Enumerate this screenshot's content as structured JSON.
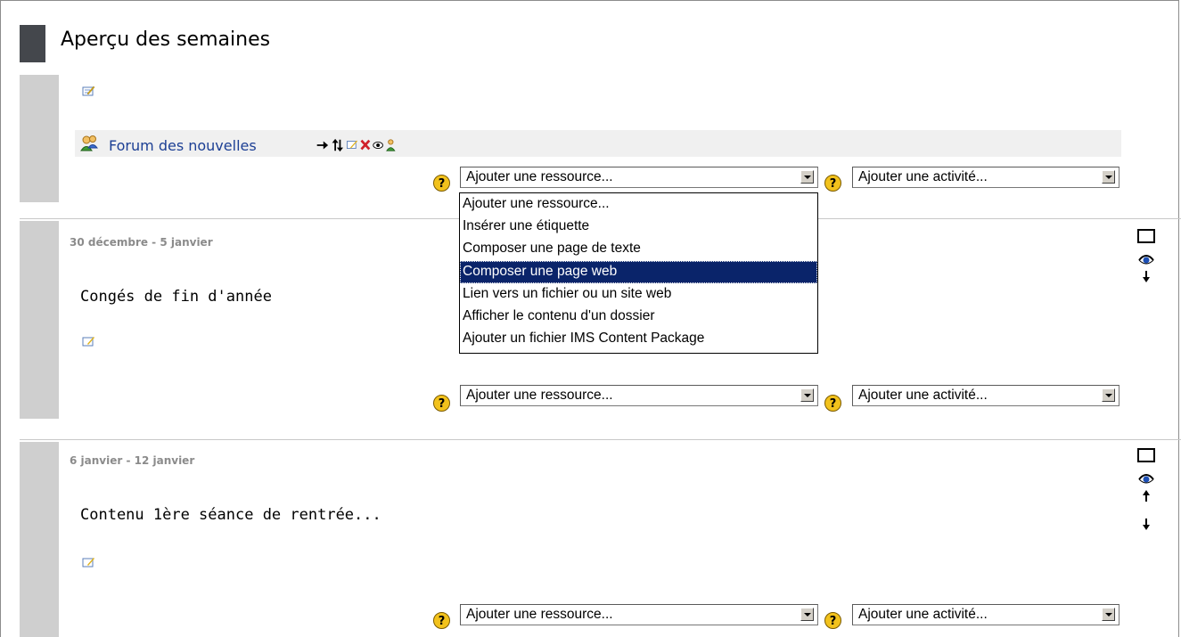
{
  "page": {
    "title": "Aperçu des semaines"
  },
  "section0": {
    "forum_label": "Forum des nouvelles",
    "resource_select": "Ajouter une ressource...",
    "activity_select": "Ajouter une activité..."
  },
  "resource_dropdown": {
    "options": [
      "Ajouter une ressource...",
      "Insérer une étiquette",
      "Composer une page de texte",
      "Composer une page web",
      "Lien vers un fichier ou un site web",
      "Afficher le contenu d'un dossier",
      "Ajouter un fichier IMS Content Package"
    ],
    "highlighted": "Composer une page web"
  },
  "section1": {
    "date": "30 décembre - 5 janvier",
    "summary": "Congés de fin d'année",
    "resource_select": "Ajouter une ressource...",
    "activity_select": "Ajouter une activité..."
  },
  "section2": {
    "date": "6 janvier - 12 janvier",
    "summary": "Contenu 1ère séance de rentrée...",
    "resource_select": "Ajouter une ressource...",
    "activity_select": "Ajouter une activité..."
  },
  "colors": {
    "link": "#1c3f94",
    "highlight": "#0a246a",
    "sidebar": "#cfcfcf",
    "header_block": "#44474c"
  },
  "icons": [
    "edit-icon",
    "forum-icon",
    "move-right-icon",
    "move-icon",
    "delete-icon",
    "eye-icon",
    "groups-icon",
    "help-icon",
    "highlight-box-icon",
    "arrow-up-icon",
    "arrow-down-icon"
  ]
}
